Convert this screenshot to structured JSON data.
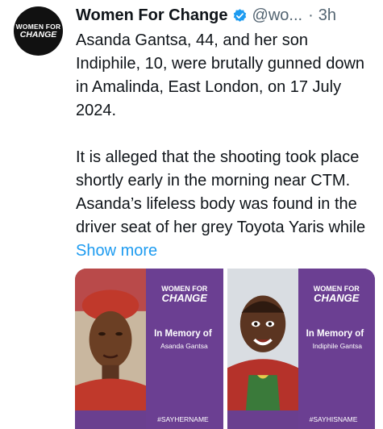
{
  "author": {
    "avatar_line1": "WOMEN FOR",
    "avatar_line2": "CHANGE",
    "name": "Women For Change",
    "handle": "@wo...",
    "separator": "·",
    "time": "3h"
  },
  "tweet": {
    "paragraph1": "Asanda Gantsa, 44, and her son Indiphile, 10, were brutally gunned down in Amalinda, East London, on 17 July 2024.",
    "paragraph2": "It is alleged that the shooting took place shortly early in the morning near CTM. Asanda’s lifeless body was found in the driver seat of her grey Toyota Yaris while",
    "show_more": "Show more"
  },
  "media": [
    {
      "logo_line1": "WOMEN FOR",
      "logo_line2": "CHANGE",
      "memory": "In Memory of",
      "name": "Asanda Gantsa",
      "hashtag": "#SAYHERNAME"
    },
    {
      "logo_line1": "WOMEN FOR",
      "logo_line2": "CHANGE",
      "memory": "In Memory of",
      "name": "Indiphile Gantsa",
      "hashtag": "#SAYHISNAME"
    }
  ],
  "colors": {
    "link": "#1d9bf0",
    "verified": "#1d9bf0",
    "card_purple": "#6b3f92"
  },
  "icons": [
    "verified-badge-icon"
  ]
}
